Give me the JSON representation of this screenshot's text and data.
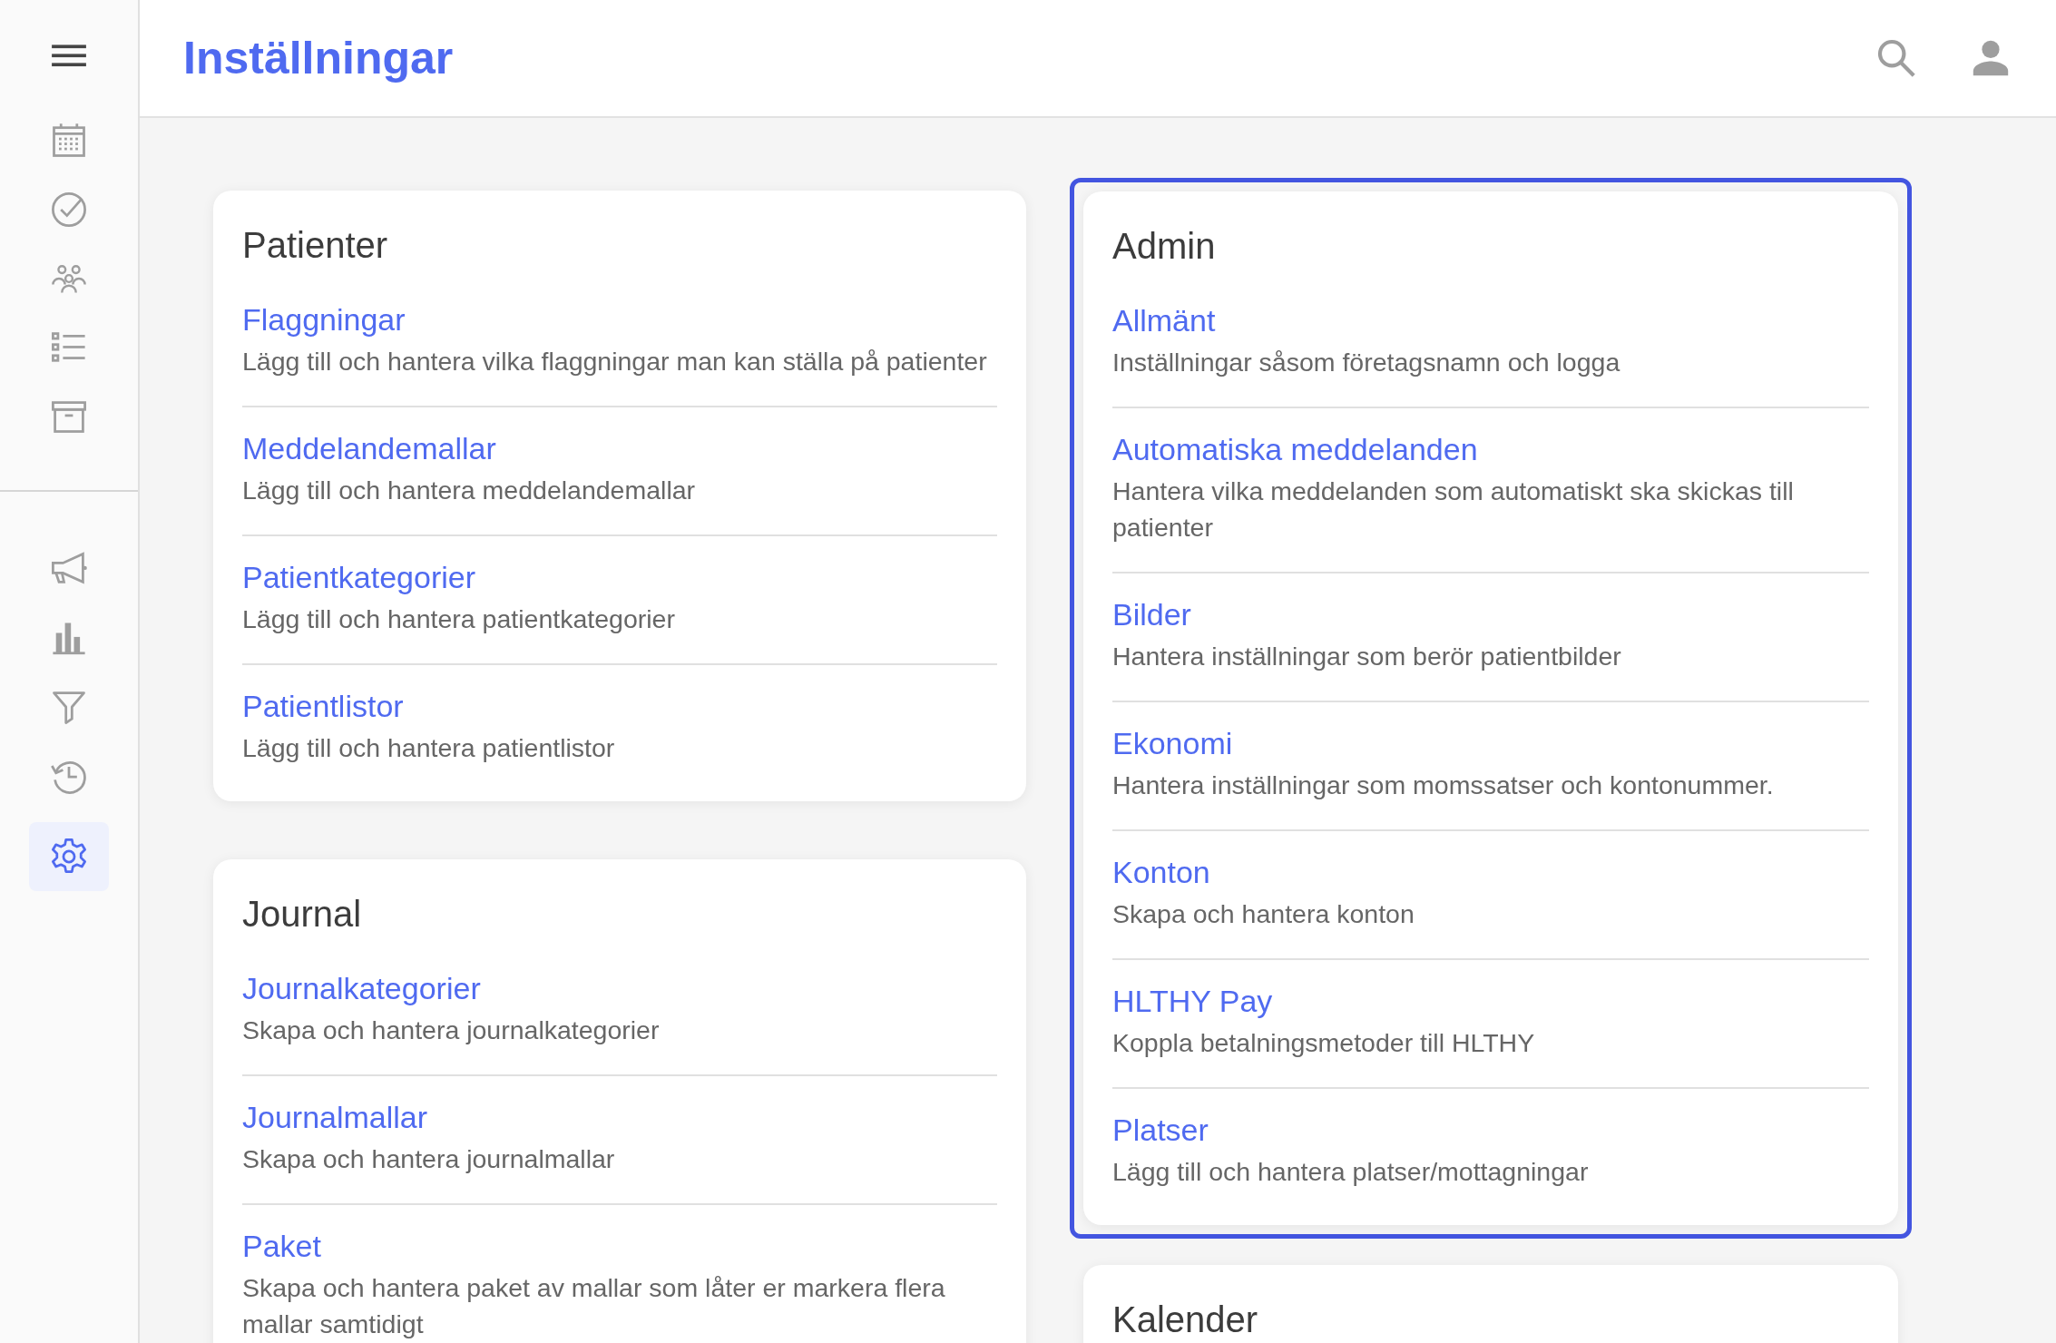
{
  "header": {
    "title": "Inställningar"
  },
  "sidebar": {
    "top_items": [
      {
        "selected": false
      },
      {
        "selected": false
      },
      {
        "selected": false
      },
      {
        "selected": false
      },
      {
        "selected": false
      }
    ],
    "bottom_items": [
      {
        "selected": false
      },
      {
        "selected": false
      },
      {
        "selected": false
      },
      {
        "selected": false
      },
      {
        "selected": true
      }
    ]
  },
  "columns": [
    {
      "sections": [
        {
          "title": "Patienter",
          "highlighted": false,
          "items": [
            {
              "label": "Flaggningar",
              "description": "Lägg till och hantera vilka flaggningar man kan ställa på patienter"
            },
            {
              "label": "Meddelandemallar",
              "description": "Lägg till och hantera meddelandemallar"
            },
            {
              "label": "Patientkategorier",
              "description": "Lägg till och hantera patientkategorier"
            },
            {
              "label": "Patientlistor",
              "description": "Lägg till och hantera patientlistor"
            }
          ]
        },
        {
          "title": "Journal",
          "highlighted": false,
          "items": [
            {
              "label": "Journalkategorier",
              "description": "Skapa och hantera journalkategorier"
            },
            {
              "label": "Journalmallar",
              "description": "Skapa och hantera journalmallar"
            },
            {
              "label": "Paket",
              "description": "Skapa och hantera paket av mallar som låter er markera flera mallar samtidigt"
            }
          ]
        }
      ]
    },
    {
      "sections": [
        {
          "title": "Admin",
          "highlighted": true,
          "items": [
            {
              "label": "Allmänt",
              "description": "Inställningar såsom företagsnamn och logga"
            },
            {
              "label": "Automatiska meddelanden",
              "description": "Hantera vilka meddelanden som automatiskt ska skickas till patienter"
            },
            {
              "label": "Bilder",
              "description": "Hantera inställningar som berör patientbilder"
            },
            {
              "label": "Ekonomi",
              "description": "Hantera inställningar som momssatser och kontonummer."
            },
            {
              "label": "Konton",
              "description": "Skapa och hantera konton"
            },
            {
              "label": "HLTHY Pay",
              "description": "Koppla betalningsmetoder till HLTHY"
            },
            {
              "label": "Platser",
              "description": "Lägg till och hantera platser/mottagningar"
            }
          ]
        },
        {
          "title": "Kalender",
          "highlighted": false
        }
      ]
    }
  ]
}
